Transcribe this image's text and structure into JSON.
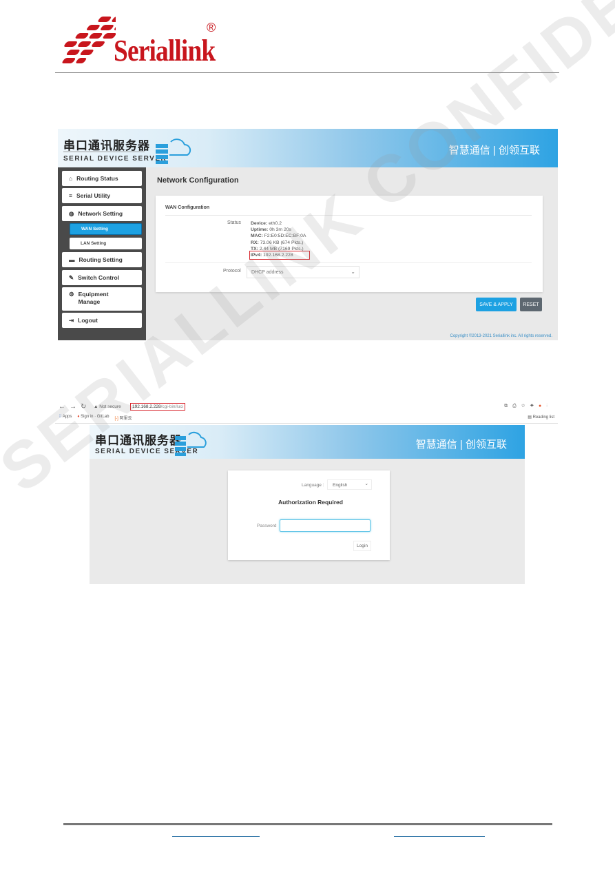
{
  "logo": {
    "brand": "Seriallink",
    "registered": "®",
    "color": "#c8161d"
  },
  "watermark": "SERIALLINK CONFIDENTIAL",
  "shot1": {
    "banner": {
      "cn_title": "串口通讯服务器",
      "en_title": "SERIAL DEVICE SERVER",
      "slogan": "智慧通信 | 创领互联"
    },
    "sidebar": [
      {
        "label": "Routing Status",
        "icon": "home-icon"
      },
      {
        "label": "Serial Utility",
        "icon": "list-icon"
      },
      {
        "label": "Network Setting",
        "icon": "globe-icon"
      },
      {
        "label": "Routing Setting",
        "icon": "router-icon"
      },
      {
        "label": "Switch Control",
        "icon": "wrench-icon"
      },
      {
        "label": "Equipment Manage",
        "icon": "gears-icon"
      },
      {
        "label": "Logout",
        "icon": "logout-icon"
      }
    ],
    "subitems": [
      {
        "label": "WAN Setting",
        "active": true
      },
      {
        "label": "LAN Setting",
        "active": false
      }
    ],
    "page_title": "Network Configuration",
    "section_title": "WAN Configuration",
    "status_label": "Status",
    "status": [
      {
        "k": "Device:",
        "v": " eth0.2"
      },
      {
        "k": "Uptime:",
        "v": " 0h 3m 20s"
      },
      {
        "k": "MAC:",
        "v": " F2:E0:5D:EC:BF:0A"
      },
      {
        "k": "RX:",
        "v": " 73.06 KB (674 Pkts.)"
      },
      {
        "k": "TX:",
        "v": " 2.44 MB (7169 Pkts.)"
      },
      {
        "k": "IPv4:",
        "v": " 192.168.2.228"
      }
    ],
    "protocol_label": "Protocol",
    "protocol_value": "DHCP address",
    "save_apply": "SAVE & APPLY",
    "reset": "RESET",
    "copyright": "Copyright ©2013-2021 Seriallink inc. All rights reserved.",
    "accent": "#1da1e2"
  },
  "shot2": {
    "browser": {
      "not_secure": "Not secure",
      "url_host": "192.168.2.228",
      "url_path": "/cgi-bin/luci",
      "bookmarks": [
        "Apps",
        "Sign in · GitLab",
        "阿里云"
      ],
      "reading_list": "Reading list"
    },
    "banner": {
      "cn_title": "串口通讯服务器",
      "en_title": "SERIAL DEVICE SERVER",
      "slogan": "智慧通信 | 创领互联"
    },
    "language_label": "Language :",
    "language_value": "English",
    "auth_title": "Authorization Required",
    "password_label": "Password",
    "password_value": "",
    "login": "Login"
  }
}
